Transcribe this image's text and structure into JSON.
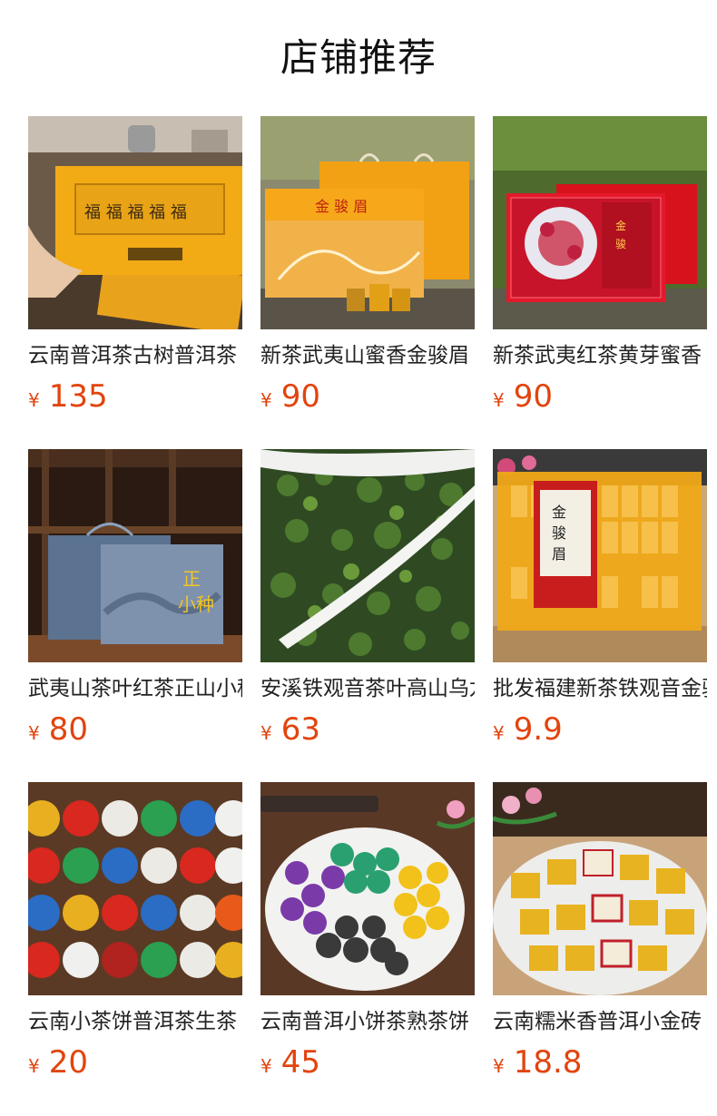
{
  "page": {
    "title": "店铺推荐"
  },
  "currency_symbol": "¥",
  "accent_color": "#e2440d",
  "products": [
    {
      "name": "云南普洱茶古树普洱茶",
      "price": "135",
      "image": "gold-tea-gift-box-photo"
    },
    {
      "name": "新茶武夷山蜜香金骏眉",
      "price": "90",
      "image": "orange-tea-gift-set-photo"
    },
    {
      "name": "新茶武夷红茶黄芽蜜香",
      "price": "90",
      "image": "red-floral-tea-box-photo"
    },
    {
      "name": "武夷山茶叶红茶正山小种",
      "price": "80",
      "image": "blue-tea-gift-box-photo"
    },
    {
      "name": "安溪铁观音茶叶高山乌龙",
      "price": "63",
      "image": "loose-oolong-leaves-photo"
    },
    {
      "name": "批发福建新茶铁观音金骏眉",
      "price": "9.9",
      "image": "small-tea-packets-box-photo"
    },
    {
      "name": "云南小茶饼普洱茶生茶",
      "price": "20",
      "image": "mini-tea-cakes-photo"
    },
    {
      "name": "云南普洱小饼茶熟茶饼",
      "price": "45",
      "image": "colorful-tea-cakes-plate-photo"
    },
    {
      "name": "云南糯米香普洱小金砖",
      "price": "18.8",
      "image": "gold-wrapped-tea-bricks-photo"
    }
  ]
}
